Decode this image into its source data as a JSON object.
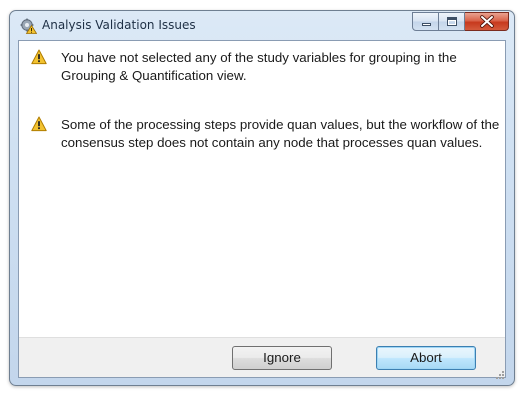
{
  "window": {
    "title": "Analysis Validation Issues",
    "title_icon": "gear-warning-icon"
  },
  "caption_buttons": {
    "minimize_icon": "minimize-icon",
    "maximize_icon": "maximize-icon",
    "close_icon": "close-icon"
  },
  "messages": [
    {
      "icon": "warning-icon",
      "text": "You have not selected any of the study variables for grouping in the Grouping & Quantification view."
    },
    {
      "icon": "warning-icon",
      "text": "Some of the processing steps provide quan values, but the workflow of the consensus step does not contain any node that processes quan values."
    }
  ],
  "buttons": {
    "ignore_label": "Ignore",
    "abort_label": "Abort"
  },
  "colors": {
    "warning_fill": "#f2c230",
    "close_button": "#c7391d",
    "default_button_border": "#3c7fb1"
  }
}
